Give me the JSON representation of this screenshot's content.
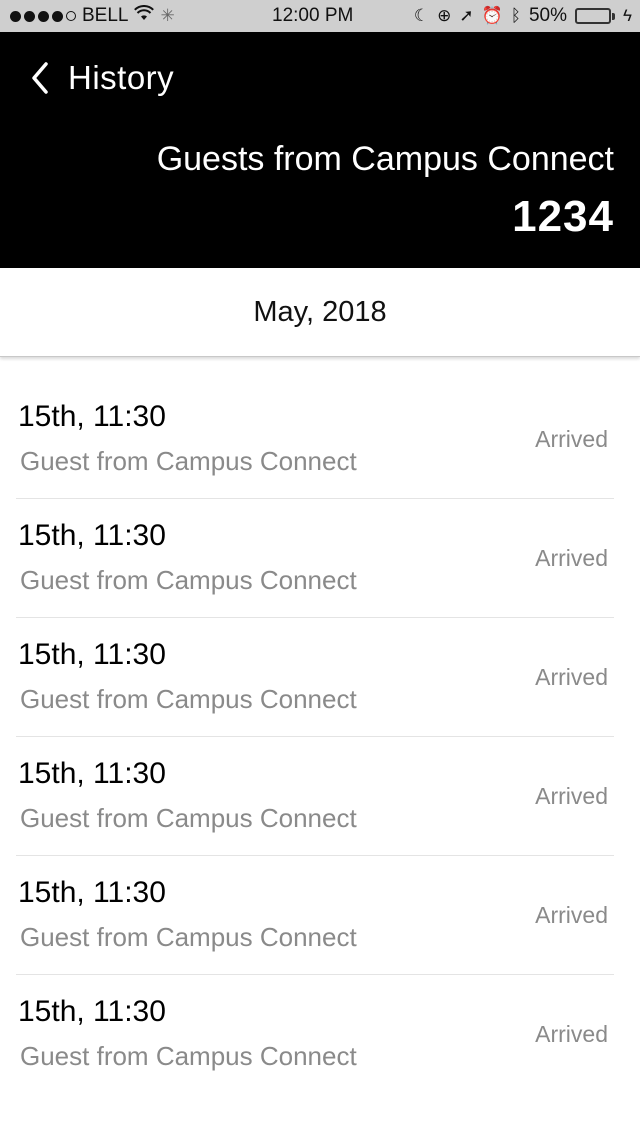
{
  "status_bar": {
    "carrier": "BELL",
    "time": "12:00 PM",
    "battery_percent_text": "50%",
    "battery_level": 0.5,
    "icons": [
      "signal-dots",
      "wifi-icon",
      "activity-icon",
      "moon-icon",
      "lock-rotation-icon",
      "location-icon",
      "alarm-icon",
      "bluetooth-icon",
      "battery-icon",
      "charging-icon"
    ]
  },
  "header": {
    "back_label": "History",
    "title": "Guests from Campus Connect",
    "count": "1234"
  },
  "month": {
    "label": "May, 2018"
  },
  "history": [
    {
      "time": "15th, 11:30",
      "description": "Guest from Campus Connect",
      "status": "Arrived"
    },
    {
      "time": "15th, 11:30",
      "description": "Guest from Campus Connect",
      "status": "Arrived"
    },
    {
      "time": "15th, 11:30",
      "description": "Guest from Campus Connect",
      "status": "Arrived"
    },
    {
      "time": "15th, 11:30",
      "description": "Guest from Campus Connect",
      "status": "Arrived"
    },
    {
      "time": "15th, 11:30",
      "description": "Guest from Campus Connect",
      "status": "Arrived"
    },
    {
      "time": "15th, 11:30",
      "description": "Guest from Campus Connect",
      "status": "Arrived"
    }
  ],
  "colors": {
    "header_bg": "#000000",
    "status_bar_bg": "#cfcfcf",
    "secondary_text": "#8a8a8a",
    "battery_fill": "#3cd24a"
  }
}
